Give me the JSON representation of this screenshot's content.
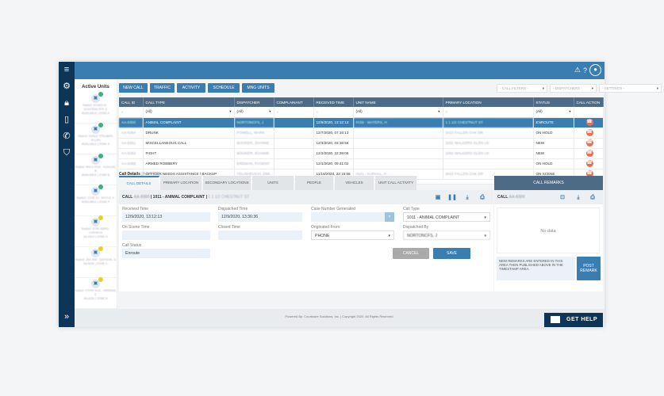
{
  "header": {
    "icons": [
      "alert-icon",
      "help-icon",
      "user-icon"
    ]
  },
  "sidebar": {
    "icons": [
      "menu-icon",
      "gear-icon",
      "lock-icon",
      "tablet-icon",
      "phone-icon",
      "shield-icon",
      "expand-icon"
    ]
  },
  "units": {
    "title": "Active Units",
    "items": [
      {
        "name": "Radio0: AC0EN #1 - SCHOWALTER, A",
        "status": "AVAILABLE | ZONE A",
        "badge": "green"
      },
      {
        "name": "Radio0: DUALE STEUBER, ALLAN",
        "status": "AVAILABLE | ZONE A",
        "badge": "green"
      },
      {
        "name": "Radio0: RNC0 #102 - KOHLER, R",
        "status": "AVAILABLE | ZONE B",
        "badge": "green"
      },
      {
        "name": "Radio0: CC0E #1 - BOYLE, K",
        "status": "AVAILABLE | ZONE X",
        "badge": "green"
      },
      {
        "name": "Radio0: 4TH0 WARD, CATHRYN",
        "status": "AA-0910 | ZONE D",
        "badge": "yellow"
      },
      {
        "name": "Radio0: ZN1 #48 - QUITZON, G",
        "status": "AA-6291 | ZONE C",
        "badge": "yellow"
      },
      {
        "name": "Radio0: CT0AF #111 - HERMAN, S",
        "status": "AA-6291 | ZONE B",
        "badge": "yellow"
      }
    ]
  },
  "toolbar": {
    "buttons": [
      "NEW CALL",
      "TRAFFIC",
      "ACTIVITY",
      "SCHEDULE",
      "MNG UNITS"
    ],
    "call_filters": "- CALL FILTERS -",
    "dispatchers": "- DISPATCHERS -",
    "settings": "- SETTINGS -"
  },
  "table": {
    "columns": [
      "CALL ID",
      "CALL TYPE",
      "DISPATCHER",
      "COMPLAINANT",
      "RECEIVED TIME",
      "UNIT NAME",
      "PRIMARY LOCATION",
      "STATUS",
      "CALL ACTION"
    ],
    "filter_all": "(All)",
    "rows": [
      [
        "AA-6300",
        "ANIMAL COMPLAINT",
        "NORTONCFS, J",
        "",
        "12/9/2020, 13:12:13",
        "#159 - WATERS, H",
        "1 1 1/2 CHESTNUT ST",
        "ENROUTE"
      ],
      [
        "AA-6294",
        "DRUNK",
        "POWELL, MARK",
        "",
        "12/7/2020, 07:16:13",
        "",
        "3423 FALLEN OAK DR",
        "ON HOLD"
      ],
      [
        "AA-6291",
        "MISCELLANEOUS CALL",
        "BOOKER, JOANNE",
        "",
        "12/3/2020, 03:38:56",
        "",
        "2281 WALKERS GLEN LN",
        "NEW"
      ],
      [
        "AA-6292",
        "FIGHT",
        "BOOKER, JOANNE",
        "",
        "12/2/2020, 22:39:06",
        "",
        "2281 WALKERS GLEN LN",
        "NEW"
      ],
      [
        "AA-6288",
        "ARMED ROBBERY",
        "ERDMAN, EVGENY",
        "",
        "12/1/2020, 09:41:02",
        "",
        "",
        "ON HOLD"
      ],
      [
        "AA-6282",
        "OFFICER NEEDS ASSISTANCE / BACKUP",
        "YELISHEVICH, DMI...",
        "",
        "11/18/2020, 22:15:58",
        "#101 - KUPHAL, H",
        "3423 FALLEN OAK DR",
        "ON SCENE"
      ]
    ]
  },
  "details": {
    "label": "Call Details",
    "label_id": "(AA-6300)",
    "tabs": [
      "CALL DETAILS",
      "PRIMARY LOCATION",
      "SECONDARY LOCATIONS",
      "UNITS",
      "PEOPLE",
      "VEHICLES",
      "UNIT CALL ACTIVITY"
    ],
    "header_prefix": "CALL",
    "call_id": "AA-6300",
    "header_type": "| 1011 - ANIMAL COMPLAINT |",
    "header_loc": "1 1 1/2 CHESTNUT ST",
    "received_label": "Received Time",
    "received": "12/9/2020, 13:12:13",
    "dispatched_label": "Dispatched Time",
    "dispatched": "12/9/2020, 13:36:36",
    "case_label": "Case Number Generated",
    "case_clear": "×",
    "calltype_label": "Call Type",
    "calltype": "1011 -  ANIMAL COMPLAINT",
    "onscene_label": "On Scene Time",
    "closed_label": "Closed Time",
    "origin_label": "Originated From",
    "origin": "PHONE",
    "dispby_label": "Dispatched By",
    "dispby": "NORTONCFS, J",
    "status_label": "Call Status",
    "status": "Enroute",
    "cancel": "CANCEL",
    "save": "SAVE"
  },
  "remarks": {
    "title": "CALL REMARKS",
    "call_prefix": "CALL",
    "call_id": "AA-6300",
    "empty": "No data",
    "placeholder": "NEW REMARKS ARE ENTERED IN THIS AREA THEN PUBLISHED ABOVE IN THE TIMESTAMP AREA.",
    "post": "POST REMARK"
  },
  "footer": {
    "text": "Powered By: Courtware Solutions, Inc. | Copyright 2020. All Rights Reserved.",
    "help": "GET HELP"
  },
  "colors": {
    "primary": "#3a7db0",
    "navy": "#0d3558",
    "header_table": "#4d6b86",
    "action": "#ef6c4f"
  }
}
